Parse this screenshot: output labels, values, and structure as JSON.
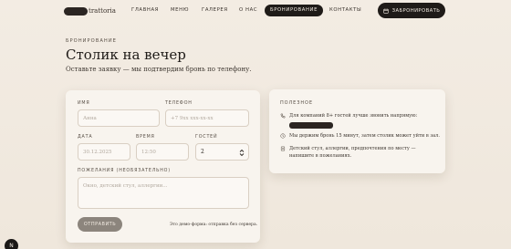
{
  "brand": {
    "name": "trattoria"
  },
  "nav": {
    "items": [
      {
        "label": "ГЛАВНАЯ"
      },
      {
        "label": "МЕНЮ"
      },
      {
        "label": "ГАЛЕРЕЯ"
      },
      {
        "label": "О НАС"
      },
      {
        "label": "БРОНИРОВАНИЕ",
        "active": true
      },
      {
        "label": "КОНТАКТЫ"
      }
    ],
    "cta_label": "ЗАБРОНИРОВАТЬ"
  },
  "header": {
    "eyebrow": "БРОНИРОВАНИЕ",
    "title": "Столик на вечер",
    "subtitle": "Оставьте заявку — мы подтвердим бронь по телефону."
  },
  "form": {
    "name": {
      "label": "ИМЯ",
      "placeholder": "Анна"
    },
    "phone": {
      "label": "ТЕЛЕФОН",
      "placeholder": "+7 9xx xxx-xx-xx"
    },
    "date": {
      "label": "ДАТА",
      "placeholder": "30.12.2025"
    },
    "time": {
      "label": "ВРЕМЯ",
      "placeholder": "12:50"
    },
    "guests": {
      "label": "ГОСТЕЙ",
      "value": "2"
    },
    "wishes": {
      "label": "ПОЖЕЛАНИЯ (НЕОБЯЗАТЕЛЬНО)",
      "placeholder": "Окно, детский стул, аллергии..."
    },
    "submit_label": "ОТПРАВИТЬ",
    "demo_note": "Это демо-форма: отправка без сервера."
  },
  "info": {
    "title": "ПОЛЕЗНОЕ",
    "rows": [
      {
        "icon": "phone-icon",
        "text": "Для компаний 8+ гостей лучше звонить напрямую:"
      },
      {
        "icon": "clock-icon",
        "text": "Мы держим бронь 15 минут, затем столик может уйти в зал."
      },
      {
        "icon": "note-icon",
        "text": "Детский стул, аллергии, предпочтения по месту — напишите в пожеланиях."
      }
    ]
  },
  "corner_badge": "N",
  "colors": {
    "accent_dark": "#1f1b18",
    "background": "#f3ece3",
    "submit_disabled": "#8c857d"
  }
}
